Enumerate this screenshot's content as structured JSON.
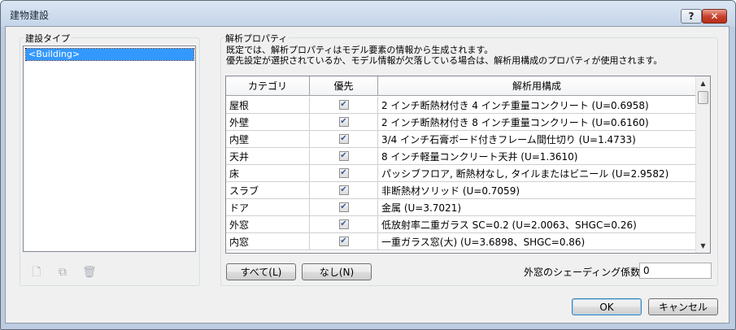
{
  "window": {
    "title": "建物建設",
    "help_label": "?",
    "close_label": "✕"
  },
  "construction_types": {
    "label": "建設タイプ",
    "items": [
      "<Building>"
    ]
  },
  "analysis_properties": {
    "label": "解析プロパティ",
    "description_line1": "既定では、解析プロパティはモデル要素の情報から生成されます。",
    "description_line2": "優先設定が選択されているか、モデル情報が欠落している場合は、解析用構成のプロパティが使用されます。",
    "columns": [
      "カテゴリ",
      "優先",
      "解析用構成"
    ],
    "rows": [
      {
        "category": "屋根",
        "override": true,
        "construction": "2 インチ断熱材付き 4 インチ重量コンクリート (U=0.6958)"
      },
      {
        "category": "外壁",
        "override": true,
        "construction": "2 インチ断熱材付き 8 インチ重量コンクリート (U=0.6160)"
      },
      {
        "category": "内壁",
        "override": true,
        "construction": "3/4 インチ石膏ボード付きフレーム間仕切り (U=1.4733)"
      },
      {
        "category": "天井",
        "override": true,
        "construction": "8 インチ軽量コンクリート天井 (U=1.3610)"
      },
      {
        "category": "床",
        "override": true,
        "construction": "パッシブフロア, 断熱材なし, タイルまたはビニール (U=2.9582)"
      },
      {
        "category": "スラブ",
        "override": true,
        "construction": "非断熱材ソリッド (U=0.7059)"
      },
      {
        "category": "ドア",
        "override": true,
        "construction": "金属 (U=3.7021)"
      },
      {
        "category": "外窓",
        "override": true,
        "construction": "低放射率二重ガラス SC=0.2 (U=2.0063、SHGC=0.26)"
      },
      {
        "category": "内窓",
        "override": true,
        "construction": "一重ガラス窓(大) (U=3.6898、SHGC=0.86)"
      }
    ],
    "select_all_label": "すべて(L)",
    "select_none_label": "なし(N)",
    "shading_label": "外窓のシェーディング係数(S):",
    "shading_value": "0"
  },
  "footer": {
    "ok_label": "OK",
    "cancel_label": "キャンセル"
  },
  "icons": [
    "new-type-icon",
    "duplicate-type-icon",
    "delete-type-icon"
  ],
  "colors": {
    "selection": "#3399ff",
    "check": "#3a5a98"
  }
}
